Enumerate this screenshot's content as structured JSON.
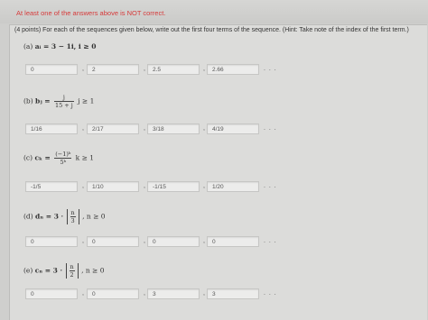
{
  "warning": "At least one of the answers above is NOT correct.",
  "instructions": "(4 points) For each of the sequences given below, write out the first four terms of the sequence. (Hint: Take note of the index of the first term.)",
  "parts": [
    {
      "label": "(a)",
      "formula": "aᵢ = 3 − 1i, i ≥ 0",
      "answers": [
        "0",
        "2",
        "2.5",
        "2.66"
      ]
    },
    {
      "label": "(b)",
      "lhs": "bⱼ =",
      "frac_num": "j",
      "frac_den": "15 + j",
      "cond": "j ≥ 1",
      "answers": [
        "1/16",
        "2/17",
        "3/18",
        "4/19"
      ]
    },
    {
      "label": "(c)",
      "lhs": "cₖ =",
      "frac_num": "(−1)ᵏ",
      "frac_den": "5ᵏ",
      "cond": "k ≥ 1",
      "answers": [
        "-1/5",
        "1/10",
        "-1/15",
        "1/20"
      ]
    },
    {
      "label": "(d)",
      "lhs": "dₙ = 3 ·",
      "frac_num": "n",
      "frac_den": "3",
      "cond": ", n ≥ 0",
      "answers": [
        "0",
        "0",
        "0",
        "0"
      ]
    },
    {
      "label": "(e)",
      "lhs": "cₙ = 3 ·",
      "frac_num": "n",
      "frac_den": "2",
      "cond": ", n ≥ 0",
      "answers": [
        "0",
        "0",
        "3",
        "3"
      ]
    }
  ],
  "separator": ",",
  "ellipsis": ". . ."
}
